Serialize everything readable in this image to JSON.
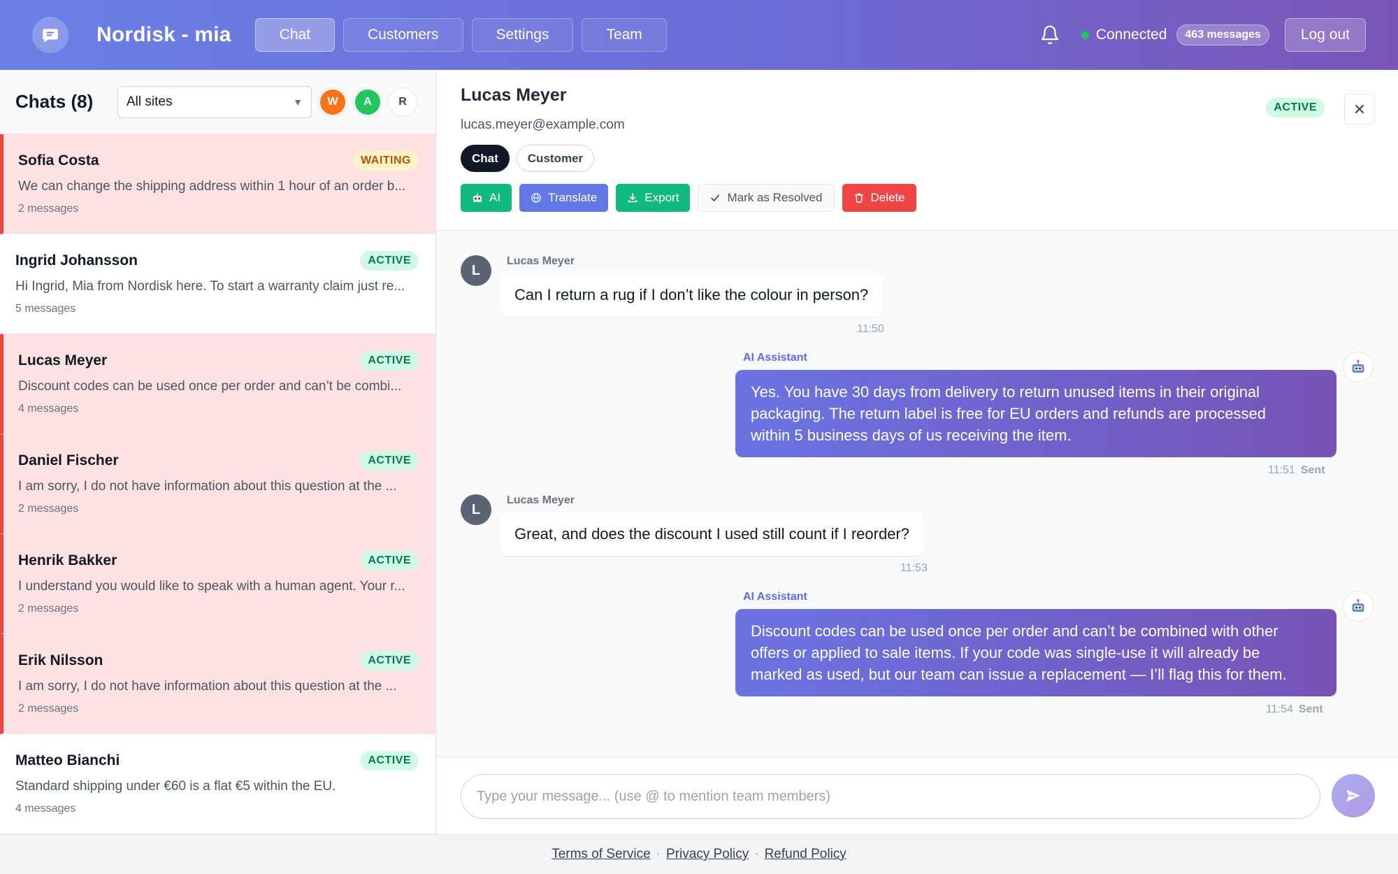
{
  "header": {
    "brand": "Nordisk - mia",
    "nav": [
      "Chat",
      "Customers",
      "Settings",
      "Team"
    ],
    "active_nav": "Chat",
    "status": "Connected",
    "message_count": "463 messages",
    "logout": "Log out"
  },
  "sidebar": {
    "title": "Chats (8)",
    "site_filter": "All sites",
    "agents": [
      {
        "initial": "W",
        "color": "#f97316"
      },
      {
        "initial": "A",
        "color": "#22c55e"
      },
      {
        "initial": "R",
        "color": "#ffffff"
      }
    ],
    "chats": [
      {
        "name": "Sofia Costa",
        "status": "WAITING",
        "preview": "We can change the shipping address within 1 hour of an order b...",
        "count": "2 messages",
        "highlight": true
      },
      {
        "name": "Ingrid Johansson",
        "status": "ACTIVE",
        "preview": "Hi Ingrid, Mia from Nordisk here. To start a warranty claim just re...",
        "count": "5 messages",
        "highlight": false
      },
      {
        "name": "Lucas Meyer",
        "status": "ACTIVE",
        "preview": "Discount codes can be used once per order and can’t be combi...",
        "count": "4 messages",
        "highlight": true
      },
      {
        "name": "Daniel Fischer",
        "status": "ACTIVE",
        "preview": "I am sorry, I do not have information about this question at the ...",
        "count": "2 messages",
        "highlight": true
      },
      {
        "name": "Henrik Bakker",
        "status": "ACTIVE",
        "preview": "I understand you would like to speak with a human agent. Your r...",
        "count": "2 messages",
        "highlight": true
      },
      {
        "name": "Erik Nilsson",
        "status": "ACTIVE",
        "preview": "I am sorry, I do not have information about this question at the ...",
        "count": "2 messages",
        "highlight": true
      },
      {
        "name": "Matteo Bianchi",
        "status": "ACTIVE",
        "preview": "Standard shipping under €60 is a flat €5 within the EU.",
        "count": "4 messages",
        "highlight": false
      }
    ]
  },
  "conversation": {
    "name": "Lucas Meyer",
    "email": "lucas.meyer@example.com",
    "status": "ACTIVE",
    "tabs": [
      "Chat",
      "Customer"
    ],
    "actions": {
      "ai": "AI",
      "translate": "Translate",
      "export": "Export",
      "resolve": "Mark as Resolved",
      "delete": "Delete"
    },
    "messages": [
      {
        "role": "user",
        "sender": "Lucas Meyer",
        "avatar": "L",
        "text": "Can I return a rug if I don’t like the colour in person?",
        "time": "11:50"
      },
      {
        "role": "ai",
        "sender": "AI Assistant",
        "lines": [
          "Yes. You have 30 days from delivery to return unused items in their original",
          "packaging. The return label is free for EU orders and refunds are processed",
          "within 5 business days of us receiving the item."
        ],
        "time": "11:51",
        "state": "Sent"
      },
      {
        "role": "user",
        "sender": "Lucas Meyer",
        "avatar": "L",
        "text": "Great, and does the discount I used still count if I reorder?",
        "time": "11:53"
      },
      {
        "role": "ai",
        "sender": "AI Assistant",
        "lines": [
          "Discount codes can be used once per order and can’t be combined with other",
          "offers or applied to sale items. If your code was single-use it will already be",
          "marked as used, but our team can issue a replacement — I’ll flag this for them."
        ],
        "time": "11:54",
        "state": "Sent"
      }
    ],
    "input_placeholder": "Type your message... (use @ to mention team members)"
  },
  "footer": {
    "links": [
      "Terms of Service",
      "Privacy Policy",
      "Refund Policy"
    ],
    "separator": "·"
  },
  "colors": {
    "accent": "#6d6cd6",
    "danger": "#ef4444",
    "success": "#10b981"
  }
}
